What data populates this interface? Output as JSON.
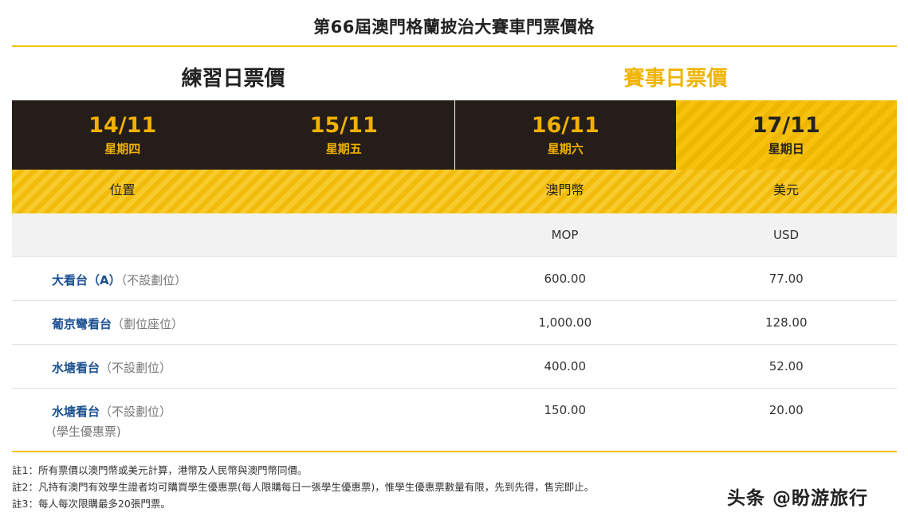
{
  "title": "第66屆澳門格蘭披治大賽車門票價格",
  "groups": {
    "practice": "練習日票價",
    "race": "賽事日票價"
  },
  "dates": [
    {
      "date": "14/11",
      "weekday": "星期四"
    },
    {
      "date": "15/11",
      "weekday": "星期五"
    },
    {
      "date": "16/11",
      "weekday": "星期六"
    },
    {
      "date": "17/11",
      "weekday": "星期日"
    }
  ],
  "header": {
    "position": "位置",
    "mop": "澳門幣",
    "usd": "美元"
  },
  "subheader": {
    "mop": "MOP",
    "usd": "USD"
  },
  "rows": [
    {
      "seat": "大看台（A）",
      "note": "（不設劃位）",
      "sub": "",
      "mop": "600.00",
      "usd": "77.00"
    },
    {
      "seat": "葡京彎看台",
      "note": "（劃位座位）",
      "sub": "",
      "mop": "1,000.00",
      "usd": "128.00"
    },
    {
      "seat": "水塘看台",
      "note": "（不設劃位）",
      "sub": "",
      "mop": "400.00",
      "usd": "52.00"
    },
    {
      "seat": "水塘看台",
      "note": "（不設劃位）",
      "sub": "(學生優惠票)",
      "mop": "150.00",
      "usd": "20.00"
    }
  ],
  "notes": [
    "註1：所有票價以澳門幣或美元計算，港幣及人民幣與澳門幣同價。",
    "註2：凡持有澳門有效學生證者均可購買學生優惠票(每人限購每日一張學生優惠票)，惟學生優惠票數量有限，先到先得，售完即止。",
    "註3：每人每次限購最多20張門票。"
  ],
  "watermark": "头条 @盼游旅行",
  "colors": {
    "accent": "#f2c200",
    "dark": "#241d1a",
    "link": "#1a4f91"
  }
}
